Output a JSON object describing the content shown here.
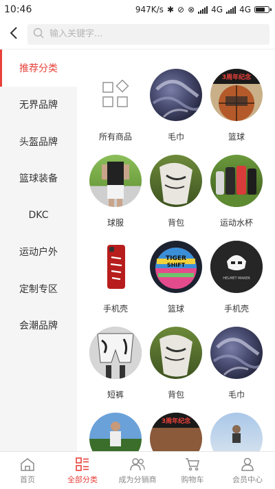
{
  "status_bar": {
    "time": "10:46",
    "speed": "947K/s",
    "network1": "4G",
    "network2": "4G"
  },
  "header": {
    "search_placeholder": "输入关键字...",
    "back_icon": "chevron-left-icon",
    "search_icon": "search-icon"
  },
  "sidebar": {
    "items": [
      {
        "label": "推荐分类",
        "active": true
      },
      {
        "label": "无界品牌"
      },
      {
        "label": "头盔品牌"
      },
      {
        "label": "篮球装备"
      },
      {
        "label": "DKC"
      },
      {
        "label": "运动户外"
      },
      {
        "label": "定制专区"
      },
      {
        "label": "会潮品牌"
      }
    ]
  },
  "grid": {
    "items": [
      {
        "label": "所有商品"
      },
      {
        "label": "毛巾"
      },
      {
        "label": "篮球"
      },
      {
        "label": "球服"
      },
      {
        "label": "背包"
      },
      {
        "label": "运动水杯"
      },
      {
        "label": "手机壳"
      },
      {
        "label": "篮球"
      },
      {
        "label": "手机壳"
      },
      {
        "label": "短裤"
      },
      {
        "label": "背包"
      },
      {
        "label": "毛巾"
      },
      {
        "label": ""
      },
      {
        "label": ""
      },
      {
        "label": ""
      }
    ]
  },
  "tabbar": {
    "items": [
      {
        "label": "首页",
        "icon": "home-icon"
      },
      {
        "label": "全部分类",
        "icon": "category-list-icon",
        "active": true
      },
      {
        "label": "成为分销商",
        "icon": "users-icon"
      },
      {
        "label": "购物车",
        "icon": "cart-icon"
      },
      {
        "label": "会员中心",
        "icon": "user-icon"
      }
    ]
  },
  "colors": {
    "accent": "#e8413a",
    "sidebar_bg": "#f5f5f5",
    "inactive_text": "#888888"
  }
}
